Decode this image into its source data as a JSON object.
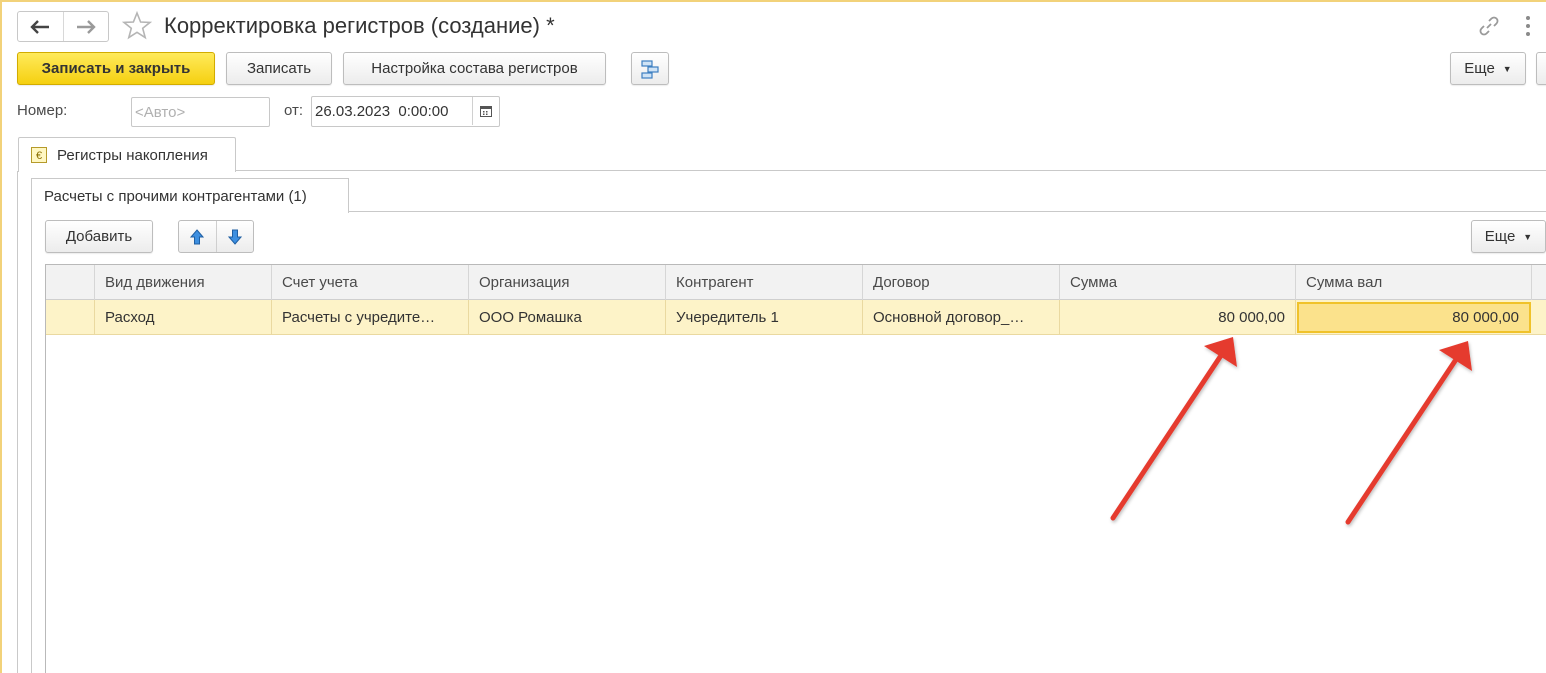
{
  "window": {
    "title": "Корректировка регистров (создание) *"
  },
  "toolbar": {
    "save_close_label": "Записать и закрыть",
    "save_label": "Записать",
    "settings_label": "Настройка состава регистров",
    "more_label": "Еще"
  },
  "form": {
    "number_label": "Номер:",
    "number_placeholder": "<Авто>",
    "from_label": "от:",
    "date_value": "26.03.2023  0:00:00"
  },
  "tabs": {
    "outer_tab": "Регистры накопления",
    "inner_tab": "Расчеты с прочими контрагентами (1)"
  },
  "table_toolbar": {
    "add_label": "Добавить",
    "more_label": "Еще"
  },
  "table": {
    "columns": [
      "Вид движения",
      "Счет учета",
      "Организация",
      "Контрагент",
      "Договор",
      "Сумма",
      "Сумма вал"
    ],
    "rows": [
      [
        "Расход",
        "Расчеты с учредите…",
        "ООО Ромашка",
        "Учередитель 1",
        "Основной договор_…",
        "80 000,00",
        "80 000,00"
      ]
    ]
  },
  "colors": {
    "accent_yellow": "#f5d010",
    "selected_row": "#fdf3c8",
    "annotation_red": "#e53a2f"
  }
}
